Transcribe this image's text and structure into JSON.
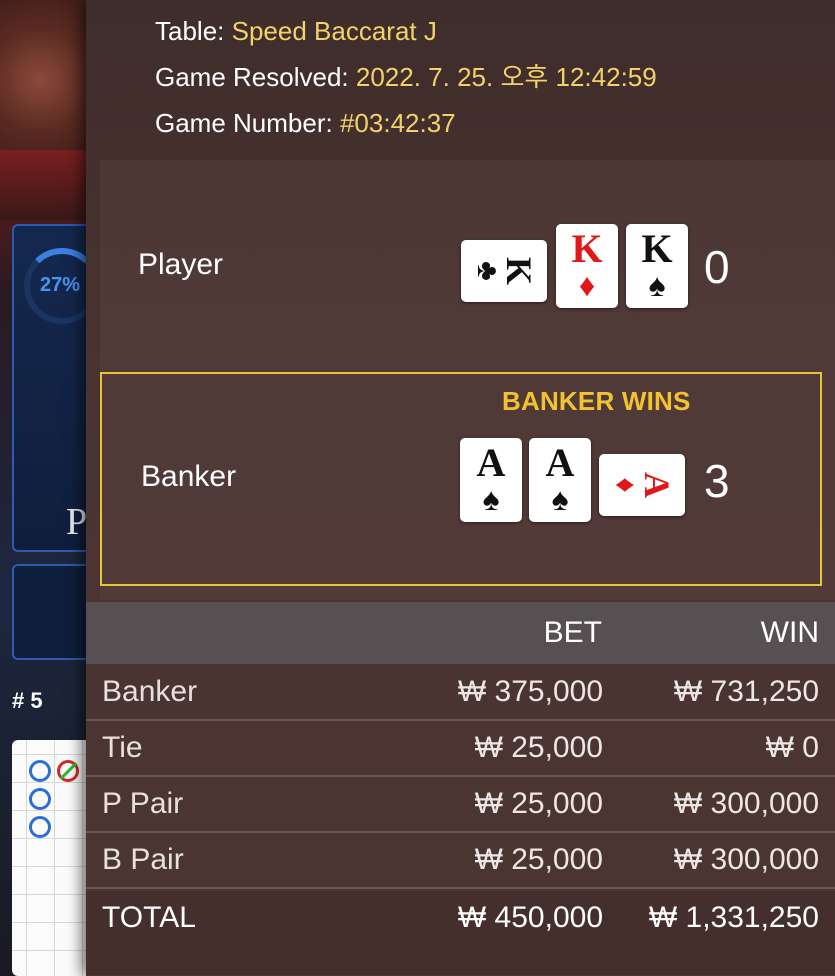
{
  "game_info": {
    "table_label": "Table:",
    "table_value": "Speed Baccarat J",
    "resolved_label": "Game Resolved:",
    "resolved_value": "2022. 7. 25. 오후 12:42:59",
    "number_label": "Game Number:",
    "number_value": "#03:42:37"
  },
  "player": {
    "label": "Player",
    "score": "0",
    "cards": [
      {
        "rank": "K",
        "suit": "♣",
        "color": "black",
        "orientation": "sideways"
      },
      {
        "rank": "K",
        "suit": "♦",
        "color": "red",
        "orientation": "upright"
      },
      {
        "rank": "K",
        "suit": "♠",
        "color": "black",
        "orientation": "upright"
      }
    ]
  },
  "banker": {
    "label": "Banker",
    "score": "3",
    "result_banner": "BANKER WINS",
    "cards": [
      {
        "rank": "A",
        "suit": "♠",
        "color": "black",
        "orientation": "upright"
      },
      {
        "rank": "A",
        "suit": "♠",
        "color": "black",
        "orientation": "upright"
      },
      {
        "rank": "A",
        "suit": "♦",
        "color": "red",
        "orientation": "sideways"
      }
    ]
  },
  "bets": {
    "header_bet": "BET",
    "header_win": "WIN",
    "rows": [
      {
        "name": "Banker",
        "bet": "₩ 375,000",
        "win": "₩ 731,250"
      },
      {
        "name": "Tie",
        "bet": "₩ 25,000",
        "win": "₩ 0"
      },
      {
        "name": "P Pair",
        "bet": "₩ 25,000",
        "win": "₩ 300,000"
      },
      {
        "name": "B Pair",
        "bet": "₩ 25,000",
        "win": "₩ 300,000"
      }
    ],
    "total": {
      "name": "TOTAL",
      "bet": "₩ 450,000",
      "win": "₩ 1,331,250"
    }
  },
  "background": {
    "progress_percent": "27%",
    "player_letter": "P",
    "round_label": "# 5"
  },
  "colors": {
    "accent_gold": "#f2d26b",
    "banner_yellow": "#f2c22f",
    "card_red": "#e01818",
    "panel_brown": "#4a3431"
  }
}
